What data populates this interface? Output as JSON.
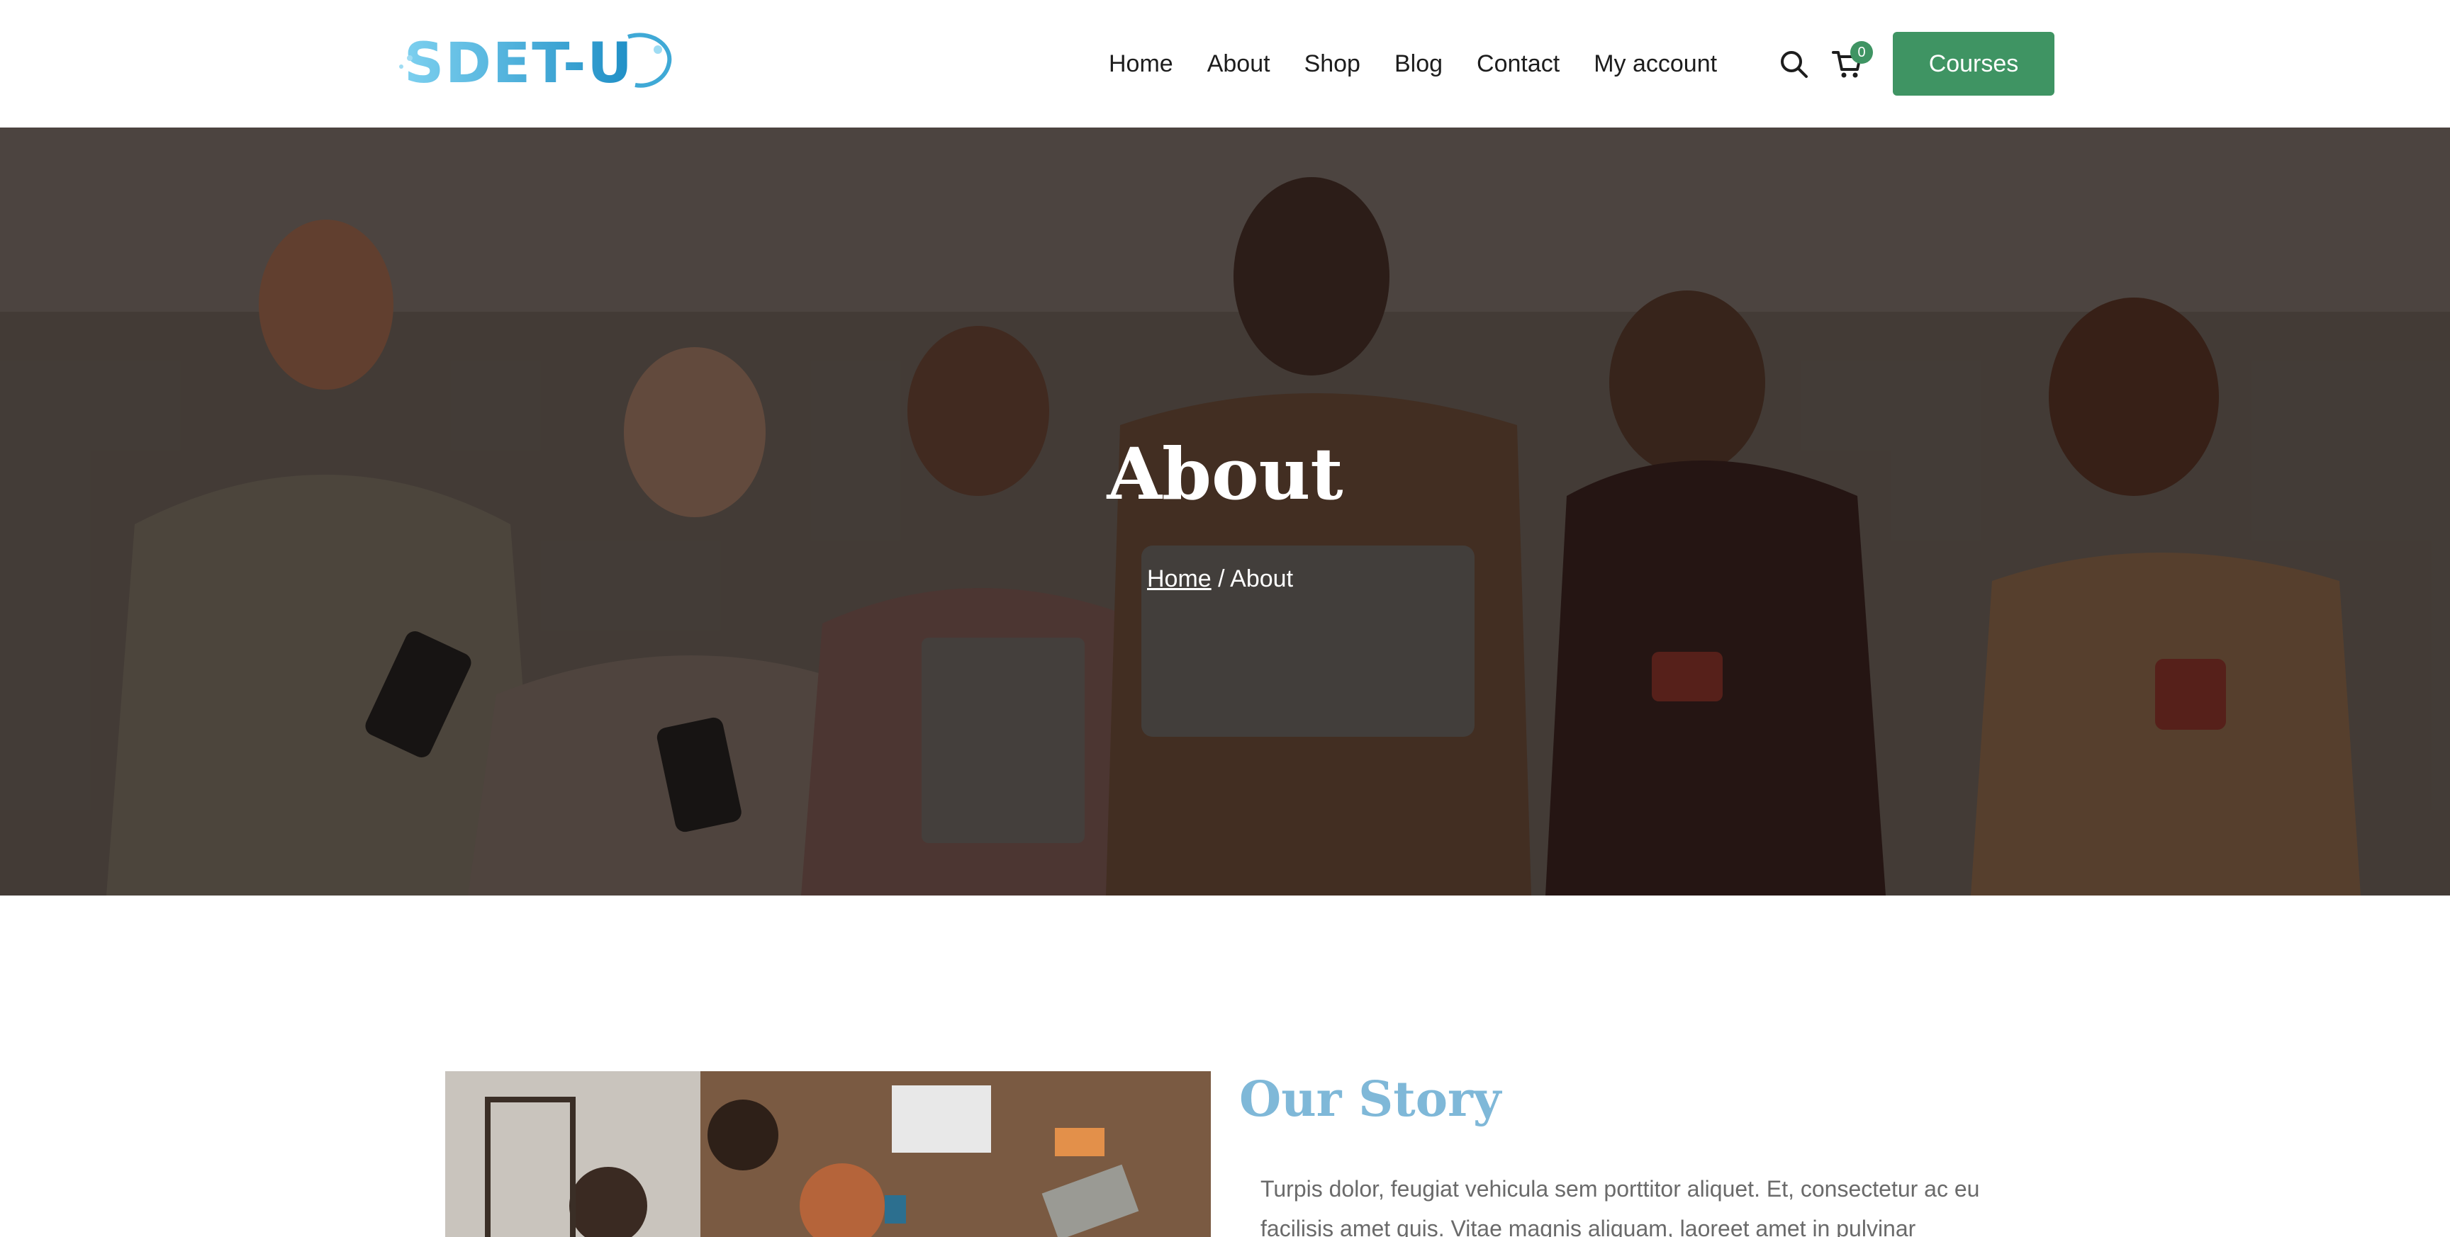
{
  "header": {
    "logo_text": "SDET-U",
    "nav": [
      {
        "label": "Home"
      },
      {
        "label": "About"
      },
      {
        "label": "Shop"
      },
      {
        "label": "Blog"
      },
      {
        "label": "Contact"
      },
      {
        "label": "My account"
      }
    ],
    "search_icon": "search-icon",
    "cart_icon": "cart-icon",
    "cart_count": "0",
    "courses_label": "Courses"
  },
  "hero": {
    "title": "About",
    "breadcrumb": {
      "home": "Home",
      "separator": " / ",
      "current": "About"
    }
  },
  "story": {
    "title": "Our Story",
    "text": "Turpis dolor, feugiat vehicula sem porttitor aliquet. Et, consectetur ac eu facilisis amet quis. Vitae magnis aliquam, laoreet amet in pulvinar"
  },
  "colors": {
    "accent_green": "#3f9463",
    "heading_blue": "#7fb8d8",
    "logo_blue": "#3fa9d6"
  }
}
